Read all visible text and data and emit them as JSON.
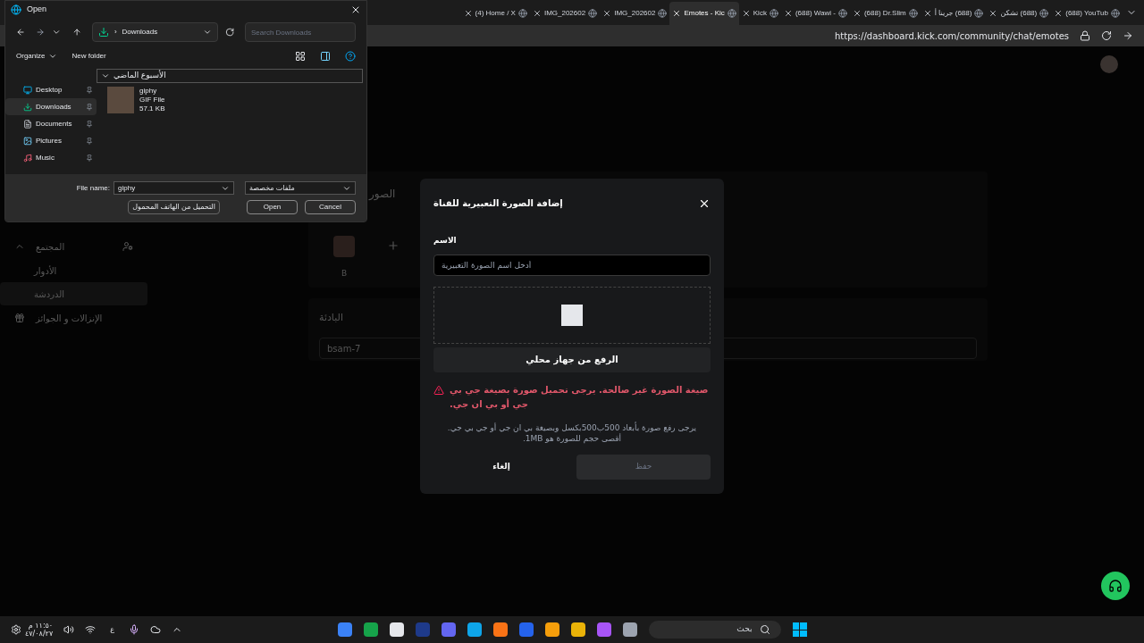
{
  "browser": {
    "tabs": [
      {
        "label": "(688) YouTub",
        "selected": false
      },
      {
        "label": "(688) تشكن",
        "selected": false
      },
      {
        "label": "(688) جرينا أ",
        "selected": false
      },
      {
        "label": "(688) Dr.Slim",
        "selected": false
      },
      {
        "label": "(688) Wawi -",
        "selected": false
      },
      {
        "label": "Kick",
        "selected": false
      },
      {
        "label": "Emotes - Kic",
        "selected": true
      },
      {
        "label": "IMG_202602",
        "selected": false
      },
      {
        "label": "IMG_202602",
        "selected": false
      },
      {
        "label": "(4) Home / X",
        "selected": false
      }
    ],
    "url": "https://dashboard.kick.com/community/chat/emotes"
  },
  "sidebar": {
    "items": [
      {
        "kind": "group",
        "label": "المجتمع",
        "expanded": true,
        "children": [
          {
            "label": "الأدوار",
            "selected": false
          },
          {
            "label": "الدردشة",
            "selected": true
          }
        ]
      },
      {
        "kind": "link",
        "label": "الإنزالات و الجوائز"
      }
    ]
  },
  "emotes_card": {
    "title": "الصور",
    "emotes": [
      {
        "label": "B"
      }
    ]
  },
  "prefix_card": {
    "title": "البادئة",
    "value": "bsam-7"
  },
  "modal": {
    "title": "إضافة الصورة التعبيرية للقناة",
    "name_label": "الاسم",
    "name_placeholder": "أدخل اسم الصورة التعبيرية",
    "upload_button": "الرفع من جهاز محلي",
    "error": "صيغة الصورة غير صالحة. يرجى تحميل صورة بصيغة جي بي جي أو بي ان جي.",
    "hint": "يرجى رفع صورة بأبعاد 500ب500بكسل وبصيغة بي ان جي أو جي بي جي. أقصى حجم للصورة هو 1MB.",
    "cancel": "إلغاء",
    "save": {
      "label": "حفظ",
      "disabled": true
    }
  },
  "file_dialog": {
    "title": "Open",
    "separator": "›",
    "location": "Downloads",
    "search_placeholder": "Search Downloads",
    "toolbar": [
      "New folder",
      "Organize"
    ],
    "nav": [
      {
        "label": "Desktop",
        "selected": false
      },
      {
        "label": "Downloads",
        "selected": true
      },
      {
        "label": "Documents",
        "selected": false
      },
      {
        "label": "Pictures",
        "selected": false
      },
      {
        "label": "Music",
        "selected": false
      }
    ],
    "group": {
      "label": "الأسبوع الماضي",
      "expanded": true
    },
    "files": [
      {
        "name": "giphy",
        "type": "GIF File",
        "size": "57.1 KB"
      }
    ],
    "file_name_label": "File name:",
    "file_name": "giphy",
    "filter": "ملفات مخصصة",
    "buttons": [
      "Cancel",
      "Open",
      "التحميل من الهاتف المحمول"
    ]
  },
  "taskbar": {
    "time": "١١:٥٠ م",
    "date": "٤٧/٠٨/٢٧",
    "language": "ع",
    "search_placeholder": "بحث"
  }
}
